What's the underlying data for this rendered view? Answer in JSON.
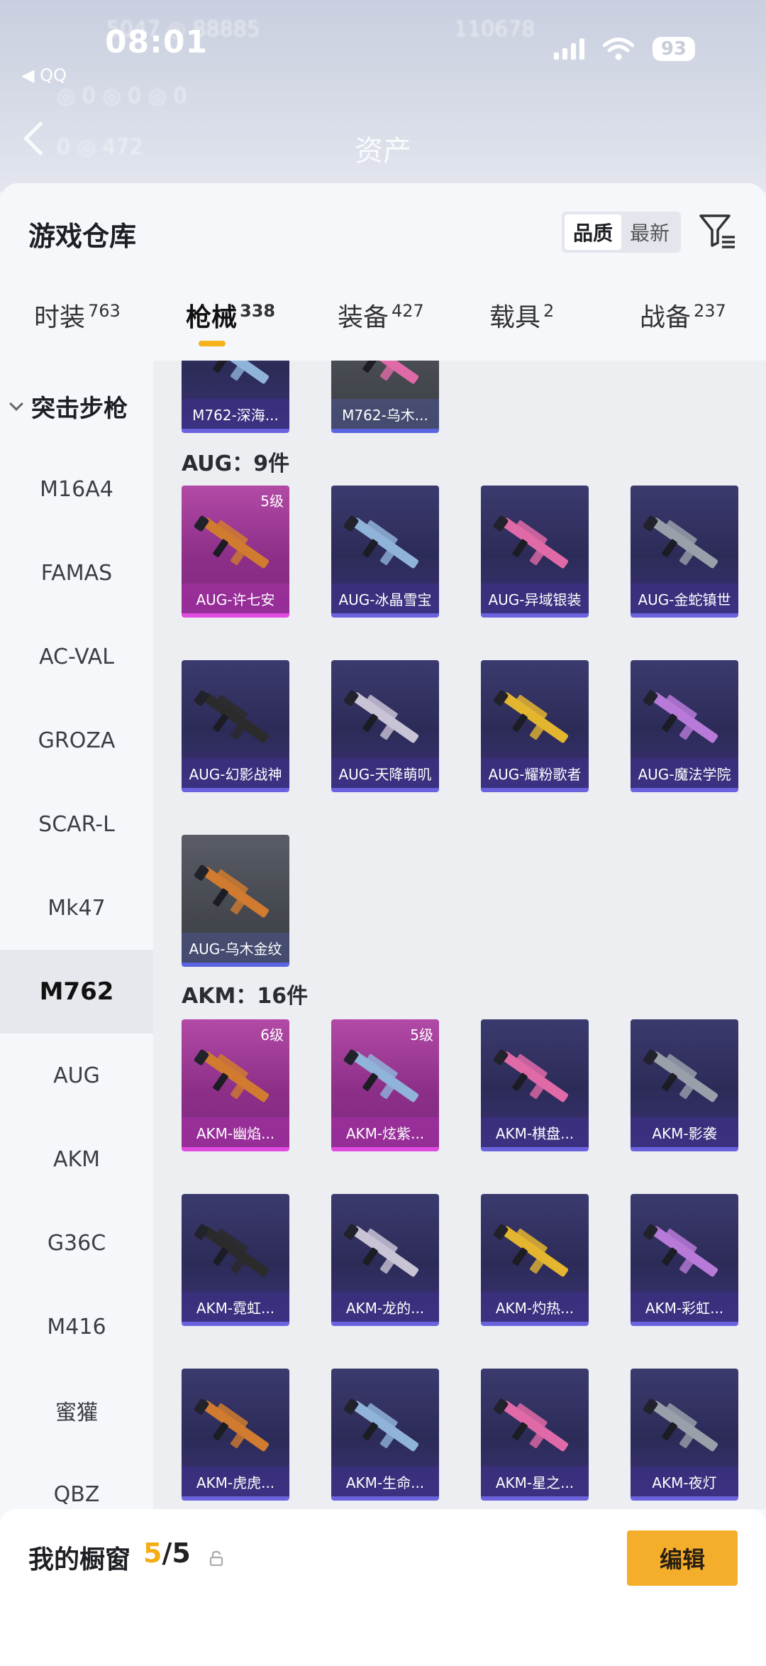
{
  "status": {
    "time": "08:01",
    "battery": "93",
    "back_app": "◀ QQ"
  },
  "background": {
    "asset_label": "资产"
  },
  "sheet": {
    "title": "游戏仓库",
    "sort": {
      "quality": "品质",
      "newest": "最新"
    }
  },
  "tabs": [
    {
      "label": "时装",
      "count": "763"
    },
    {
      "label": "枪械",
      "count": "338"
    },
    {
      "label": "装备",
      "count": "427"
    },
    {
      "label": "载具",
      "count": "2"
    },
    {
      "label": "战备",
      "count": "237"
    }
  ],
  "sidebar": {
    "group": "突击步枪",
    "items": [
      "M16A4",
      "FAMAS",
      "AC-VAL",
      "GROZA",
      "SCAR-L",
      "Mk47",
      "M762",
      "AUG",
      "AKM",
      "G36C",
      "M416",
      "蜜獾",
      "QBZ"
    ],
    "active": "M762"
  },
  "sections": {
    "aug_title": "AUG：9件",
    "akm_title": "AKM：16件"
  },
  "cards": {
    "m762": [
      {
        "label": "M762-深海...",
        "style": "purple"
      },
      {
        "label": "M762-乌木...",
        "style": "gray"
      }
    ],
    "aug": [
      {
        "label": "AUG-许七安",
        "style": "pink",
        "level": "5级"
      },
      {
        "label": "AUG-冰晶雪宝",
        "style": "purple"
      },
      {
        "label": "AUG-异域银装",
        "style": "purple"
      },
      {
        "label": "AUG-金蛇镇世",
        "style": "purple"
      },
      {
        "label": "AUG-幻影战神",
        "style": "purple"
      },
      {
        "label": "AUG-天降萌叽",
        "style": "purple"
      },
      {
        "label": "AUG-耀粉歌者",
        "style": "purple"
      },
      {
        "label": "AUG-魔法学院",
        "style": "purple"
      },
      {
        "label": "AUG-乌木金纹",
        "style": "gray"
      }
    ],
    "akm": [
      {
        "label": "AKM-幽焰...",
        "style": "pink",
        "level": "6级"
      },
      {
        "label": "AKM-炫紫...",
        "style": "pink",
        "level": "5级"
      },
      {
        "label": "AKM-棋盘...",
        "style": "purple"
      },
      {
        "label": "AKM-影袭",
        "style": "purple"
      },
      {
        "label": "AKM-霓虹...",
        "style": "purple"
      },
      {
        "label": "AKM-龙的...",
        "style": "purple"
      },
      {
        "label": "AKM-灼热...",
        "style": "purple"
      },
      {
        "label": "AKM-彩虹...",
        "style": "purple"
      },
      {
        "label": "AKM-虎虎...",
        "style": "purple"
      },
      {
        "label": "AKM-生命...",
        "style": "purple"
      },
      {
        "label": "AKM-星之...",
        "style": "purple"
      },
      {
        "label": "AKM-夜灯",
        "style": "purple"
      }
    ]
  },
  "bottom": {
    "title": "我的橱窗",
    "count_current": "5",
    "count_total": "/5",
    "edit_label": "编辑"
  },
  "colors": {
    "accent": "#f5b21b",
    "card_purple": "#2c2b58",
    "card_pink": "#8d2f88"
  }
}
